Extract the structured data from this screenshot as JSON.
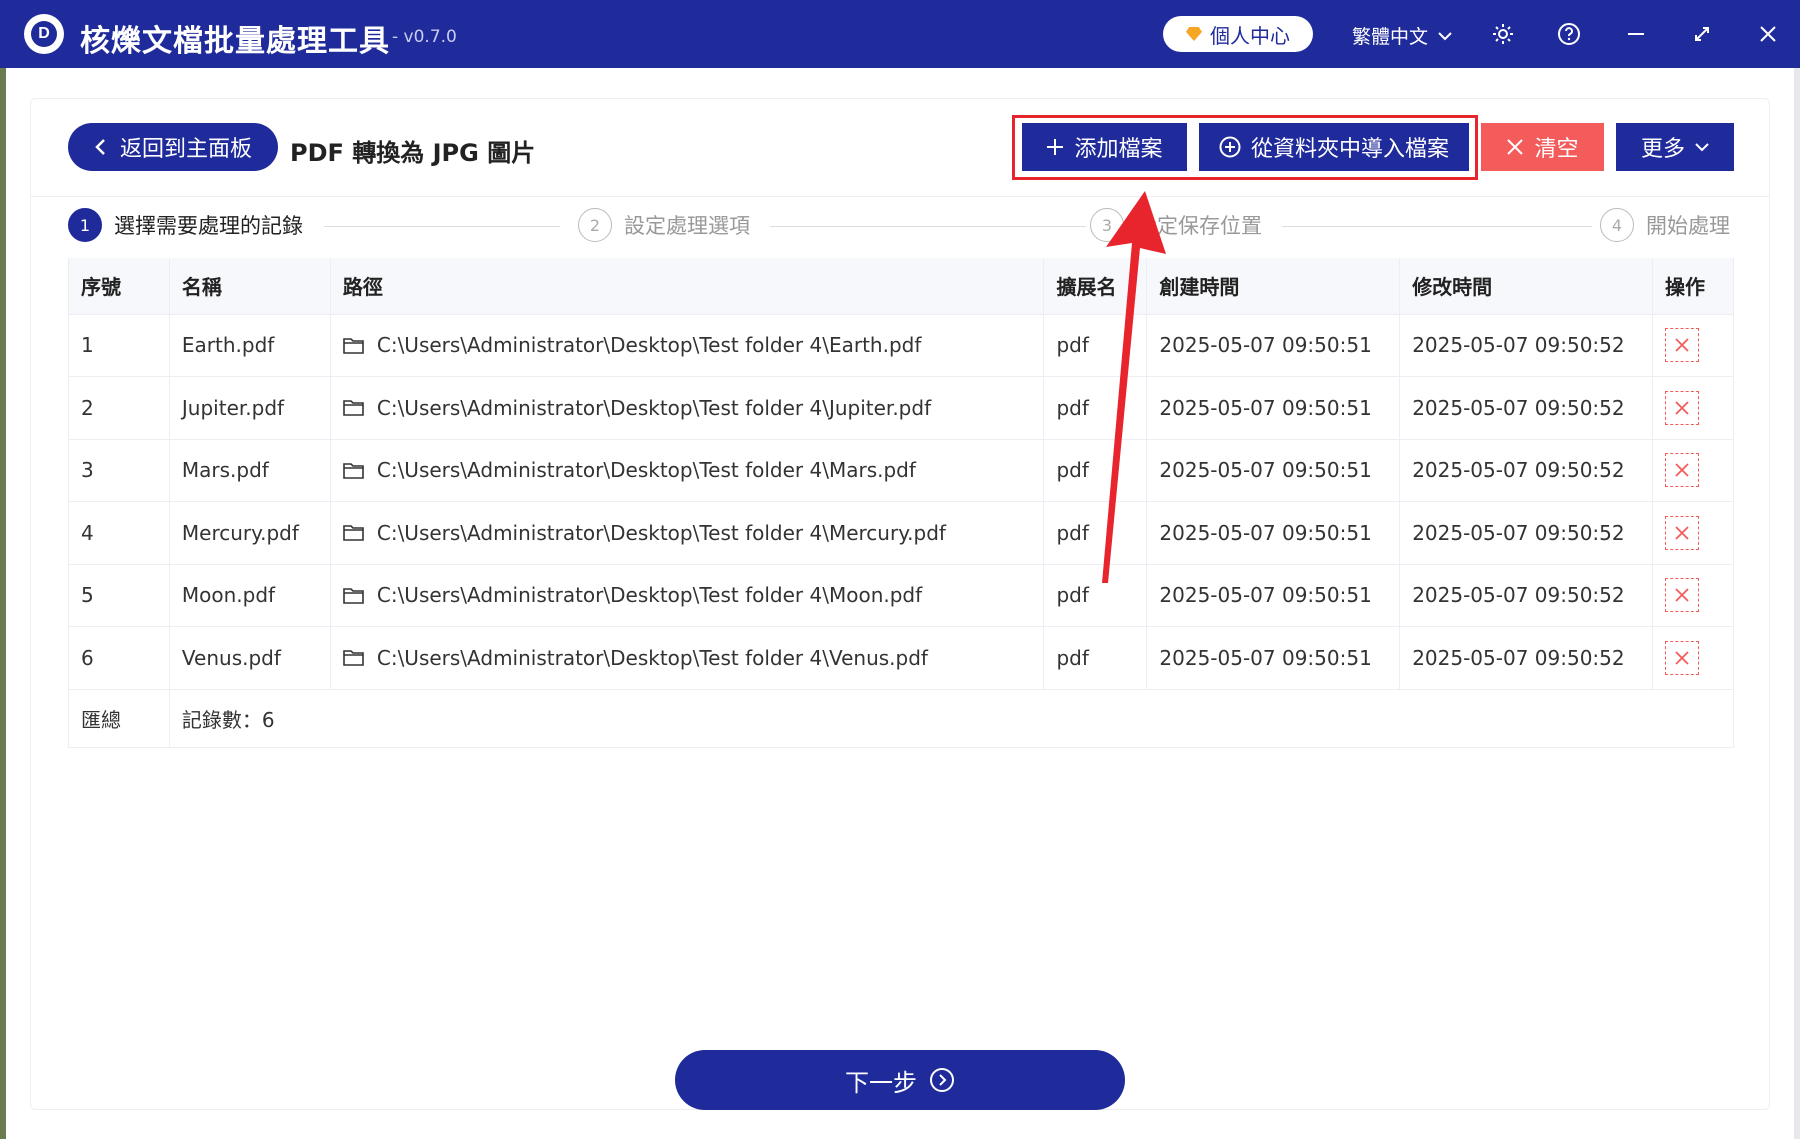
{
  "app": {
    "title": "核爍文檔批量處理工具",
    "version": "- v0.7.0",
    "personal_center": "個人中心",
    "language": "繁體中文"
  },
  "icons": {
    "logo": "D",
    "back": "chevron-left-icon",
    "plus": "plus-icon",
    "import": "plus-circle-icon",
    "clear": "close-icon",
    "more": "chevron-down-icon",
    "next": "arrow-right-circle-icon",
    "folder": "folder-icon",
    "delete": "close-icon"
  },
  "colors": {
    "primary": "#1f2a9b",
    "danger": "#f45b5b",
    "highlight": "#e8252c"
  },
  "header": {
    "back_label": "返回到主面板",
    "page_title": "PDF 轉換為 JPG 圖片",
    "add_label": "添加檔案",
    "import_label": "從資料夾中導入檔案",
    "clear_label": "清空",
    "more_label": "更多"
  },
  "steps": [
    {
      "num": "1",
      "label": "選擇需要處理的記錄"
    },
    {
      "num": "2",
      "label": "設定處理選項"
    },
    {
      "num": "3",
      "label": "設定保存位置"
    },
    {
      "num": "4",
      "label": "開始處理"
    }
  ],
  "table": {
    "columns": [
      "序號",
      "名稱",
      "路徑",
      "擴展名",
      "創建時間",
      "修改時間",
      "操作"
    ],
    "rows": [
      {
        "index": "1",
        "name": "Earth.pdf",
        "path": "C:\\Users\\Administrator\\Desktop\\Test folder 4\\Earth.pdf",
        "ext": "pdf",
        "created": "2025-05-07 09:50:51",
        "modified": "2025-05-07 09:50:52"
      },
      {
        "index": "2",
        "name": "Jupiter.pdf",
        "path": "C:\\Users\\Administrator\\Desktop\\Test folder 4\\Jupiter.pdf",
        "ext": "pdf",
        "created": "2025-05-07 09:50:51",
        "modified": "2025-05-07 09:50:52"
      },
      {
        "index": "3",
        "name": "Mars.pdf",
        "path": "C:\\Users\\Administrator\\Desktop\\Test folder 4\\Mars.pdf",
        "ext": "pdf",
        "created": "2025-05-07 09:50:51",
        "modified": "2025-05-07 09:50:52"
      },
      {
        "index": "4",
        "name": "Mercury.pdf",
        "path": "C:\\Users\\Administrator\\Desktop\\Test folder 4\\Mercury.pdf",
        "ext": "pdf",
        "created": "2025-05-07 09:50:51",
        "modified": "2025-05-07 09:50:52"
      },
      {
        "index": "5",
        "name": "Moon.pdf",
        "path": "C:\\Users\\Administrator\\Desktop\\Test folder 4\\Moon.pdf",
        "ext": "pdf",
        "created": "2025-05-07 09:50:51",
        "modified": "2025-05-07 09:50:52"
      },
      {
        "index": "6",
        "name": "Venus.pdf",
        "path": "C:\\Users\\Administrator\\Desktop\\Test folder 4\\Venus.pdf",
        "ext": "pdf",
        "created": "2025-05-07 09:50:51",
        "modified": "2025-05-07 09:50:52"
      }
    ],
    "summary_label": "匯總",
    "summary_count": "記錄數：6"
  },
  "footer": {
    "next_label": "下一步"
  }
}
